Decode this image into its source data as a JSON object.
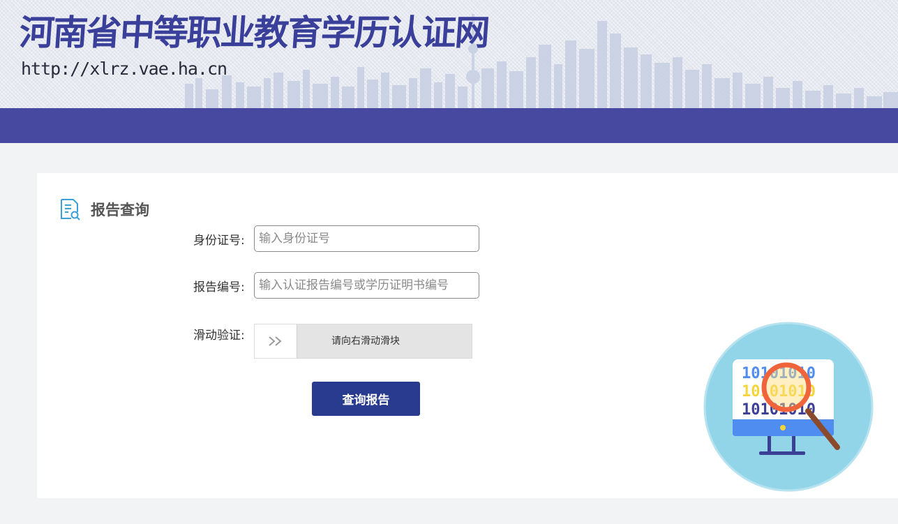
{
  "header": {
    "site_title": "河南省中等职业教育学历认证网",
    "site_url": "http://xlrz.vae.ha.cn"
  },
  "section": {
    "title": "报告查询",
    "icon": "document-search-icon"
  },
  "form": {
    "id_label": "身份证号:",
    "id_placeholder": "输入身份证号",
    "id_value": "",
    "report_label": "报告编号:",
    "report_placeholder": "输入认证报告编号或学历证明书编号",
    "report_value": "",
    "captcha_label": "滑动验证:",
    "slider_hint": "请向右滑动滑块",
    "slider_icon": "double-chevron-right-icon",
    "submit_label": "查询报告"
  },
  "illustration": {
    "binary_lines": [
      "10101010",
      "10101010",
      "10101010"
    ],
    "icon": "monitor-magnifier-icon"
  },
  "colors": {
    "brand": "#3a3f9a",
    "navbar": "#46499f",
    "button": "#283b8e",
    "page_bg": "#f2f3f5"
  }
}
